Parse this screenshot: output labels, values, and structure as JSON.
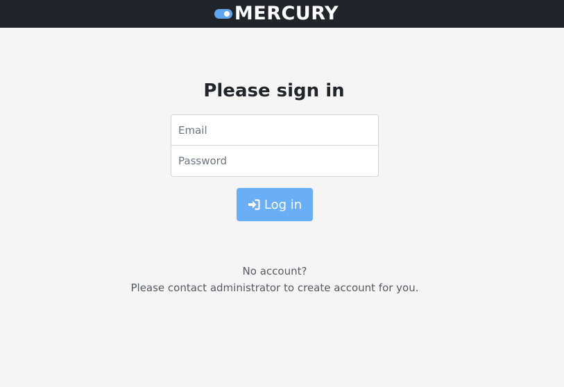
{
  "header": {
    "brand": "MERCURY",
    "logo_icon": "toggle-icon"
  },
  "login": {
    "title": "Please sign in",
    "email_placeholder": "Email",
    "password_placeholder": "Password",
    "button_label": "Log in",
    "button_icon": "sign-in-icon"
  },
  "footer": {
    "line1": "No account?",
    "line2": "Please contact administrator to create account for you."
  },
  "colors": {
    "navbar_bg": "#212529",
    "page_bg": "#f5f5f5",
    "accent": "#6aaef8",
    "logo_toggle": "#5fa4ef"
  }
}
